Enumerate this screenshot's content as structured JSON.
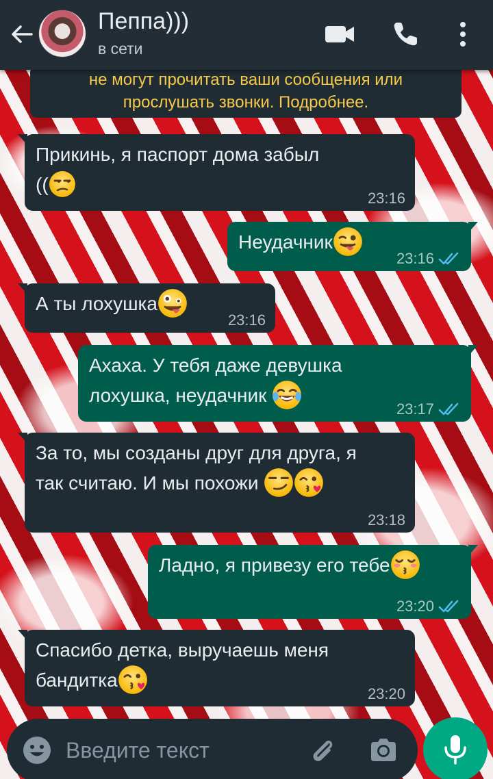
{
  "header": {
    "contact_name": "Пеппа)))",
    "status": "в сети"
  },
  "notice": {
    "line1": "не могут прочитать ваши сообщения или",
    "line2": "прослушать звонки. Подробнее."
  },
  "messages": [
    {
      "direction": "in",
      "lines": [
        "Прикинь, я паспорт дома забыл",
        "(("
      ],
      "emoji": [
        "unamused-face"
      ],
      "time": "23:16"
    },
    {
      "direction": "out",
      "lines": [
        "Неудачник"
      ],
      "emoji": [
        "winking-tongue-face"
      ],
      "time": "23:16",
      "read": true
    },
    {
      "direction": "in",
      "lines": [
        "А ты лохушка"
      ],
      "emoji": [
        "zany-face"
      ],
      "time": "23:16"
    },
    {
      "direction": "out",
      "lines": [
        "Ахаха. У тебя даже девушка",
        "лохушка, неудачник "
      ],
      "emoji": [
        "tears-of-joy-face"
      ],
      "time": "23:17",
      "read": true
    },
    {
      "direction": "in",
      "lines": [
        "За то, мы созданы друг для друга, я",
        "так считаю. И мы похожи "
      ],
      "emoji": [
        "smirking-face",
        "kissing-heart-face"
      ],
      "time": "23:18"
    },
    {
      "direction": "out",
      "lines": [
        "Ладно, я привезу его тебе"
      ],
      "emoji": [
        "kissing-closed-eyes-face"
      ],
      "time": "23:20",
      "read": true
    },
    {
      "direction": "in",
      "lines": [
        "Спасибо детка, выручаешь меня",
        "бандитка"
      ],
      "emoji": [
        "kissing-heart-face"
      ],
      "time": "23:20"
    }
  ],
  "composer": {
    "placeholder": "Введите текст"
  },
  "colors": {
    "header_bg": "#232d36",
    "incoming_bubble": "#202c33",
    "outgoing_bubble": "#005c4b",
    "read_ticks": "#53bdeb",
    "notice_text": "#f7c948",
    "mic_button": "#00a884"
  }
}
